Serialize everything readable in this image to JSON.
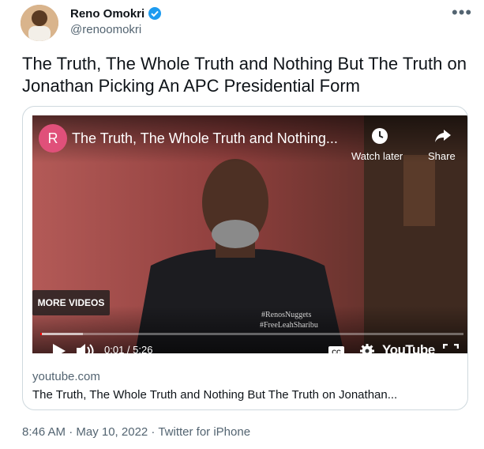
{
  "author": {
    "name": "Reno Omokri",
    "handle": "@renoomokri",
    "verified": true,
    "verified_color": "#1d9bf0",
    "avatar_icon": "person-photo"
  },
  "more_label": "•••",
  "tweet_text": "The Truth, The Whole Truth and Nothing But The Truth on Jonathan Picking An APC Presidential Form",
  "video": {
    "channel_initial": "R",
    "channel_color": "#e0507a",
    "title": "The Truth, The Whole Truth and Nothing...",
    "watch_later": "Watch later",
    "share": "Share",
    "more_videos": "MORE VIDEOS",
    "time": "0:01 / 5:26",
    "progress": 0.003,
    "logo": "YouTube",
    "shirt_text": "#RenosNuggets\n#FreeLeahSharibu"
  },
  "card": {
    "domain": "youtube.com",
    "title": "The Truth, The Whole Truth and Nothing But The Truth on Jonathan..."
  },
  "meta": "8:46 AM · May 10, 2022 · Twitter for iPhone"
}
